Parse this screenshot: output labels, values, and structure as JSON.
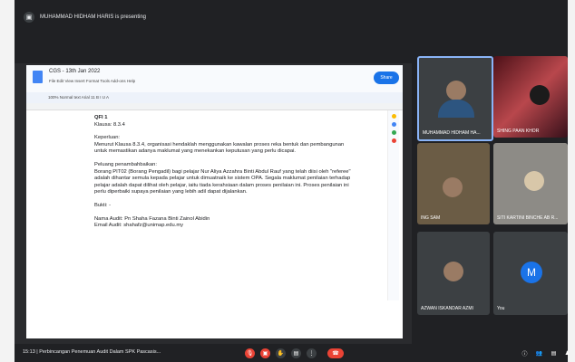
{
  "presenter": {
    "text": "MUHAMMAD HIDHAM HARIS is presenting"
  },
  "doc": {
    "title": "CGS - 13th Jan 2022",
    "menu": "File  Edit  View  Insert  Format  Tools  Add-ons  Help",
    "share": "Share",
    "toolbar": "100%   Normal text   Arial   11   B  I  U  A",
    "content": {
      "heading": "QFI 1",
      "clause": "Klausa: 8.3.4",
      "need_label": "Keperluan:",
      "need_body": "Menurut Klausa 8.3.4, organisasi hendaklah menggunakan kawalan proses reka bentuk dan pembangunan untuk memastikan adanya maklumat yang menekankan keputusan yang perlu dicapai.",
      "improve_label": "Peluang penambahbaikan:",
      "improve_body": "Borang PIT02 (Borang Pengadil) bagi pelajar Nur Aliya Azzahra Binti Abdul Rauf yang telah diisi oleh \"referee\" adalah dihantar semula kepada pelajar untuk dimuatnaik ke sistem OPA. Segala maklumat penilaian terhadap pelajar adalah dapat dilihat oleh pelajar, iaitu tiada kerahsiaan dalam proses penilaian ini. Proses penilaian ini perlu diperbaiki supaya penilaian yang lebih adil dapat dijalankan.",
      "evidence": "Bukti: -",
      "auditor": "Nama Audit: Pn Shaha Fazana Binti Zainol Abidin",
      "email": "Email Audit: shahafz@unimap.edu.my"
    }
  },
  "participants": [
    {
      "name": "MUHAMMAD HIDHAM HA..."
    },
    {
      "name": "SHING PAAN KHOR"
    },
    {
      "name": "ING SAM"
    },
    {
      "name": "SITI KARTINI BINCHE AB R..."
    },
    {
      "name": "AZWAN ISKANDAR AZMI"
    },
    {
      "name": "You",
      "initial": "M"
    }
  ],
  "meeting": {
    "time_title": "15:13  |  Perbincangan Penemuan Audit Dalam SPK Pascasis..."
  }
}
